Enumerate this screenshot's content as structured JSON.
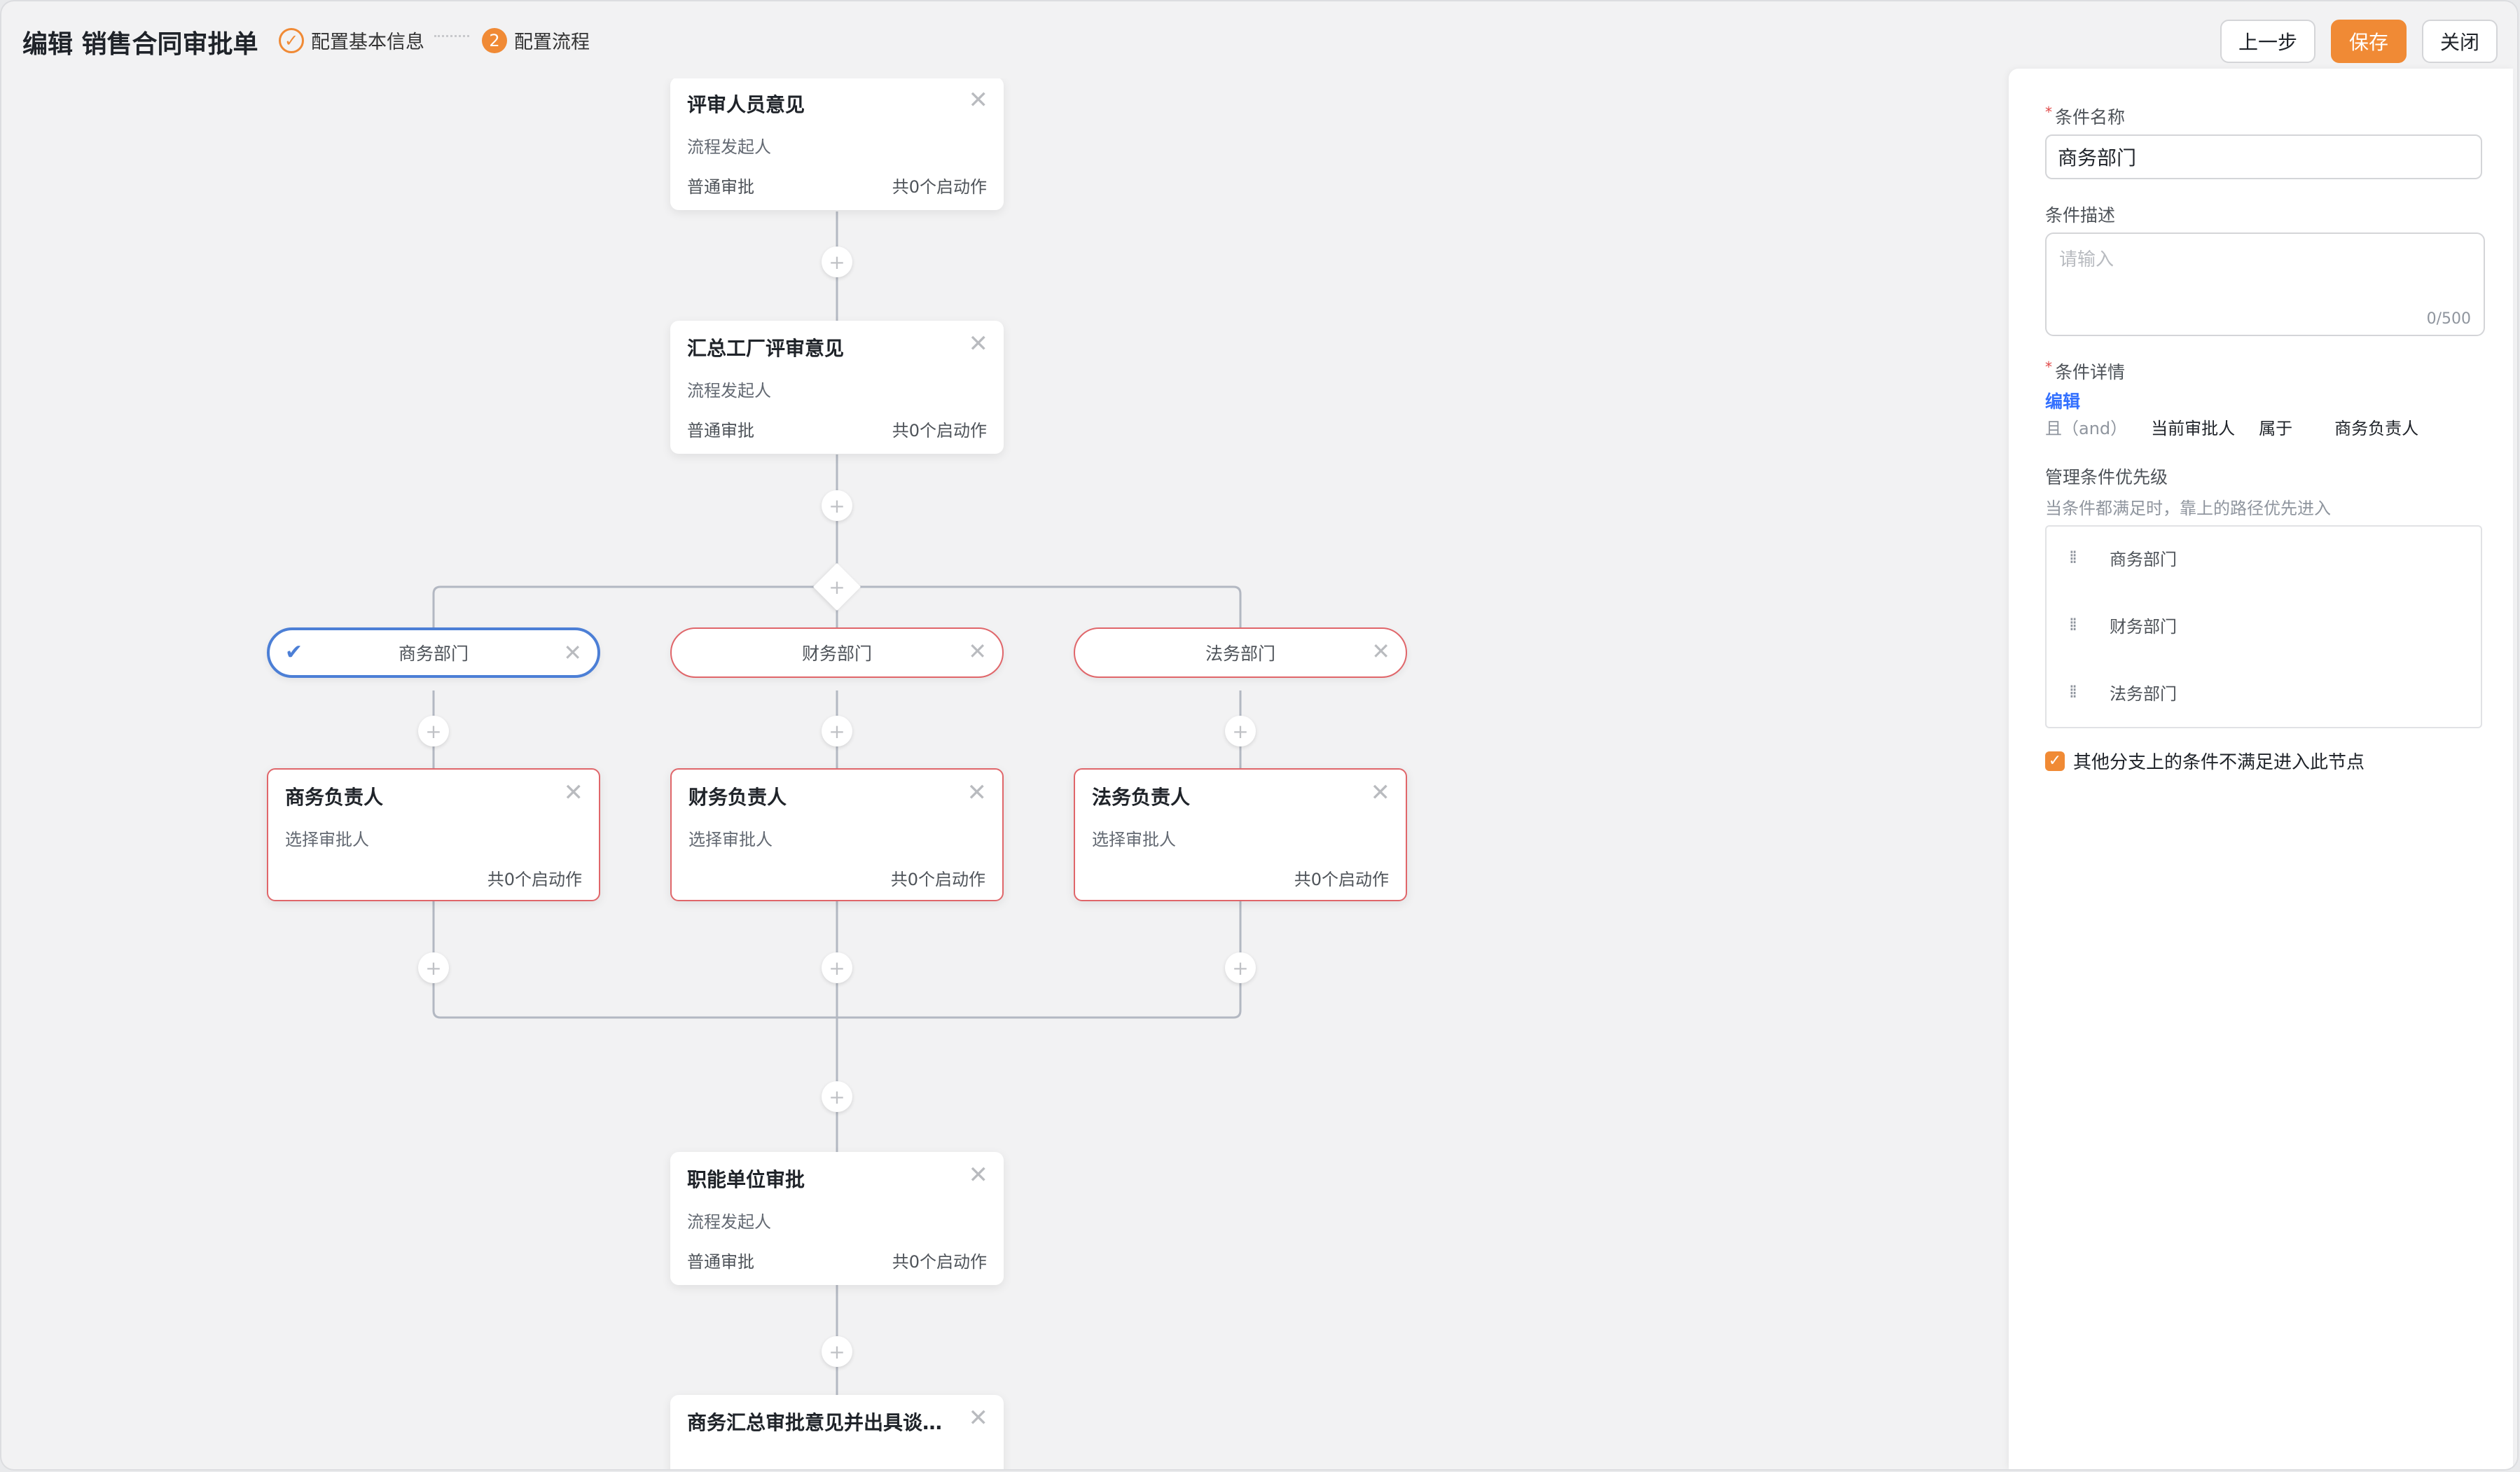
{
  "header": {
    "title": "编辑 销售合同审批单",
    "steps": [
      {
        "label": "配置基本信息",
        "status": "done",
        "icon": "check-icon"
      },
      {
        "label": "配置流程",
        "status": "current",
        "number": "2"
      }
    ],
    "buttons": {
      "prev": "上一步",
      "save": "保存",
      "close": "关闭"
    },
    "accent_color": "#f08a35"
  },
  "flow": {
    "nodes": {
      "reviewer": {
        "title": "评审人员意见",
        "sub": "流程发起人",
        "type": "普通审批",
        "actions": "共0个启动作"
      },
      "factory": {
        "title": "汇总工厂评审意见",
        "sub": "流程发起人",
        "type": "普通审批",
        "actions": "共0个启动作"
      },
      "functional": {
        "title": "职能单位审批",
        "sub": "流程发起人",
        "type": "普通审批",
        "actions": "共0个启动作"
      },
      "business_summary": {
        "title": "商务汇总审批意见并出具谈判..."
      }
    },
    "conditions": [
      {
        "label": "商务部门",
        "selected": true
      },
      {
        "label": "财务部门",
        "selected": false
      },
      {
        "label": "法务部门",
        "selected": false
      }
    ],
    "branch_nodes": [
      {
        "title": "商务负责人",
        "sub": "选择审批人",
        "actions": "共0个启动作"
      },
      {
        "title": "财务负责人",
        "sub": "选择审批人",
        "actions": "共0个启动作"
      },
      {
        "title": "法务负责人",
        "sub": "选择审批人",
        "actions": "共0个启动作"
      }
    ],
    "plus_glyph": "+",
    "close_glyph": "✕",
    "check_glyph": "✔",
    "error_color": "#e0666a",
    "selected_color": "#4c7fd6"
  },
  "panel": {
    "name_label": "条件名称",
    "name_value": "商务部门",
    "desc_label": "条件描述",
    "desc_placeholder": "请输入",
    "desc_count": "0/500",
    "detail_label": "条件详情",
    "edit_link": "编辑",
    "rule": {
      "op": "且（and）",
      "field": "当前审批人",
      "relation": "属于",
      "value": "商务负责人"
    },
    "priority_label": "管理条件优先级",
    "priority_hint": "当条件都满足时，靠上的路径优先进入",
    "priority_items": [
      "商务部门",
      "财务部门",
      "法务部门"
    ],
    "fallback_checkbox": "其他分支上的条件不满足进入此节点",
    "fallback_checked": true
  }
}
